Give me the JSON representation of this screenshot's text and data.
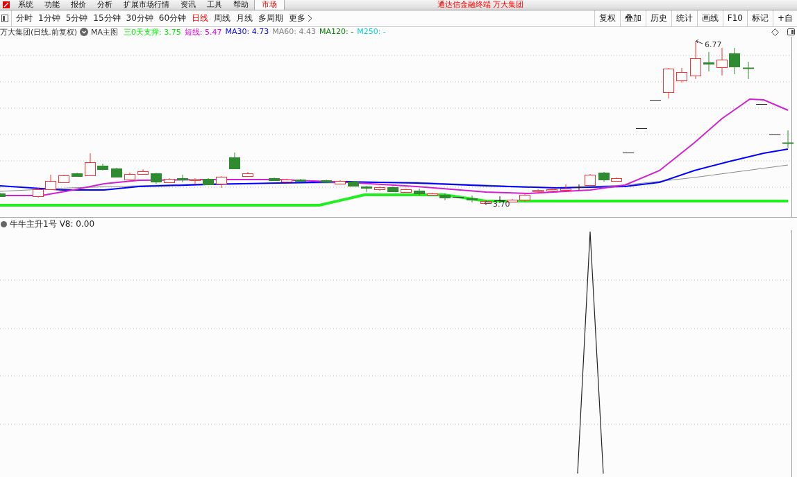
{
  "menu_bar": {
    "items": [
      {
        "label": "系统",
        "selected": false
      },
      {
        "label": "功能",
        "selected": false
      },
      {
        "label": "报价",
        "selected": false
      },
      {
        "label": "分析",
        "selected": false
      },
      {
        "label": "扩展市场行情",
        "selected": false
      },
      {
        "label": "资讯",
        "selected": false
      },
      {
        "label": "工具",
        "selected": false
      },
      {
        "label": "帮助",
        "selected": false
      },
      {
        "label": "市场",
        "selected": true
      }
    ],
    "title": "通达信金融终端 万大集团"
  },
  "period_bar": {
    "periods": [
      {
        "label": "分时",
        "selected": false
      },
      {
        "label": "1分钟",
        "selected": false
      },
      {
        "label": "5分钟",
        "selected": false
      },
      {
        "label": "15分钟",
        "selected": false
      },
      {
        "label": "30分钟",
        "selected": false
      },
      {
        "label": "60分钟",
        "selected": false
      },
      {
        "label": "日线",
        "selected": true
      },
      {
        "label": "周线",
        "selected": false
      },
      {
        "label": "月线",
        "selected": false
      },
      {
        "label": "多周期",
        "selected": false
      }
    ],
    "more": "更多",
    "tools": [
      "复权",
      "叠加",
      "历史",
      "统计",
      "画线",
      "F10",
      "标记",
      "+自"
    ]
  },
  "chart_header": {
    "security": "万大集团(日线.前复权)",
    "template": "MA主图",
    "indicators": [
      {
        "label": "三0天支撑: 3.75",
        "color": "#00ee00"
      },
      {
        "label": "短线: 5.47",
        "color": "#e000e0"
      },
      {
        "label": "MA30: 4.73",
        "color": "#0000ff"
      },
      {
        "label": "MA60: 4.43",
        "color": "#808080"
      },
      {
        "label": "MA120: -",
        "color": "#008000"
      },
      {
        "label": "M250: -",
        "color": "#00d0d0"
      }
    ]
  },
  "main_chart": {
    "high_label": "6.77",
    "low_label": "3.70"
  },
  "sub_chart": {
    "name": "牛牛主升1号",
    "reading": "V8: 0.00"
  }
}
